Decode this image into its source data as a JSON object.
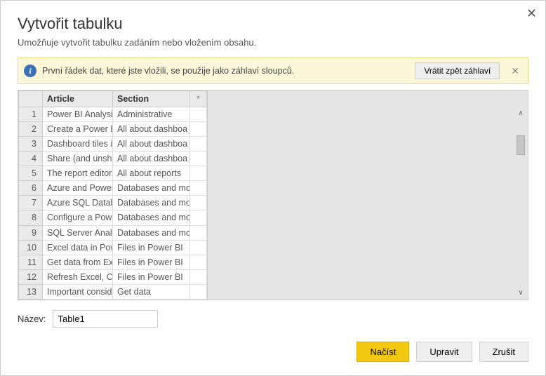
{
  "dialog": {
    "title": "Vytvořit tabulku",
    "subtitle": "Umožňuje vytvořit tabulku zadáním nebo vložením obsahu."
  },
  "info_bar": {
    "text": "První řádek dat, které jste vložili, se použije jako záhlaví sloupců.",
    "undo_button": "Vrátit zpět záhlaví"
  },
  "columns": {
    "article": "Article",
    "section": "Section",
    "star": "*"
  },
  "rows": [
    {
      "n": "1",
      "article": "Power BI Analysis",
      "section": "Administrative"
    },
    {
      "n": "2",
      "article": "Create a Power BI",
      "section": "All about dashboa"
    },
    {
      "n": "3",
      "article": "Dashboard tiles in",
      "section": "All about dashboa"
    },
    {
      "n": "4",
      "article": "Share (and unshar",
      "section": "All about dashboa"
    },
    {
      "n": "5",
      "article": "The report editor..",
      "section": "All about reports"
    },
    {
      "n": "6",
      "article": "Azure and Power B",
      "section": "Databases and mo"
    },
    {
      "n": "7",
      "article": "Azure SQL Databa",
      "section": "Databases and mo"
    },
    {
      "n": "8",
      "article": "Configure a Power",
      "section": "Databases and mo"
    },
    {
      "n": "9",
      "article": "SQL Server Analys",
      "section": "Databases and mo"
    },
    {
      "n": "10",
      "article": "Excel data in Powe",
      "section": "Files in Power BI"
    },
    {
      "n": "11",
      "article": "Get data from Exce",
      "section": "Files in Power BI"
    },
    {
      "n": "12",
      "article": "Refresh Excel, CSV",
      "section": "Files in Power BI"
    },
    {
      "n": "13",
      "article": "Important conside",
      "section": "Get data"
    }
  ],
  "name": {
    "label": "Název:",
    "value": "Table1"
  },
  "footer": {
    "load": "Načíst",
    "edit": "Upravit",
    "cancel": "Zrušit"
  }
}
